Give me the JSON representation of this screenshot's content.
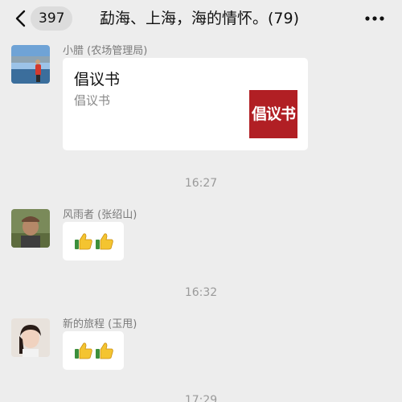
{
  "header": {
    "back_icon": "chevron-left-icon",
    "unread_count": "397",
    "title": "勐海、上海，海的情怀。(79)",
    "more_icon": "ellipsis-icon"
  },
  "messages": [
    {
      "sender": "小腊 (农场管理局)",
      "card": {
        "title": "倡议书",
        "desc": "倡议书",
        "thumb_text": "倡议书"
      }
    },
    {
      "sender": "风雨者 (张绍山)",
      "content": "thumbs-up x2"
    },
    {
      "sender": "新的旅程 (玉甩)",
      "content": "thumbs-up x2"
    }
  ],
  "timestamps": [
    "16:27",
    "16:32",
    "17:29"
  ],
  "colors": {
    "background": "#ededed",
    "bubble": "#ffffff",
    "thumb": "#b11f24"
  }
}
